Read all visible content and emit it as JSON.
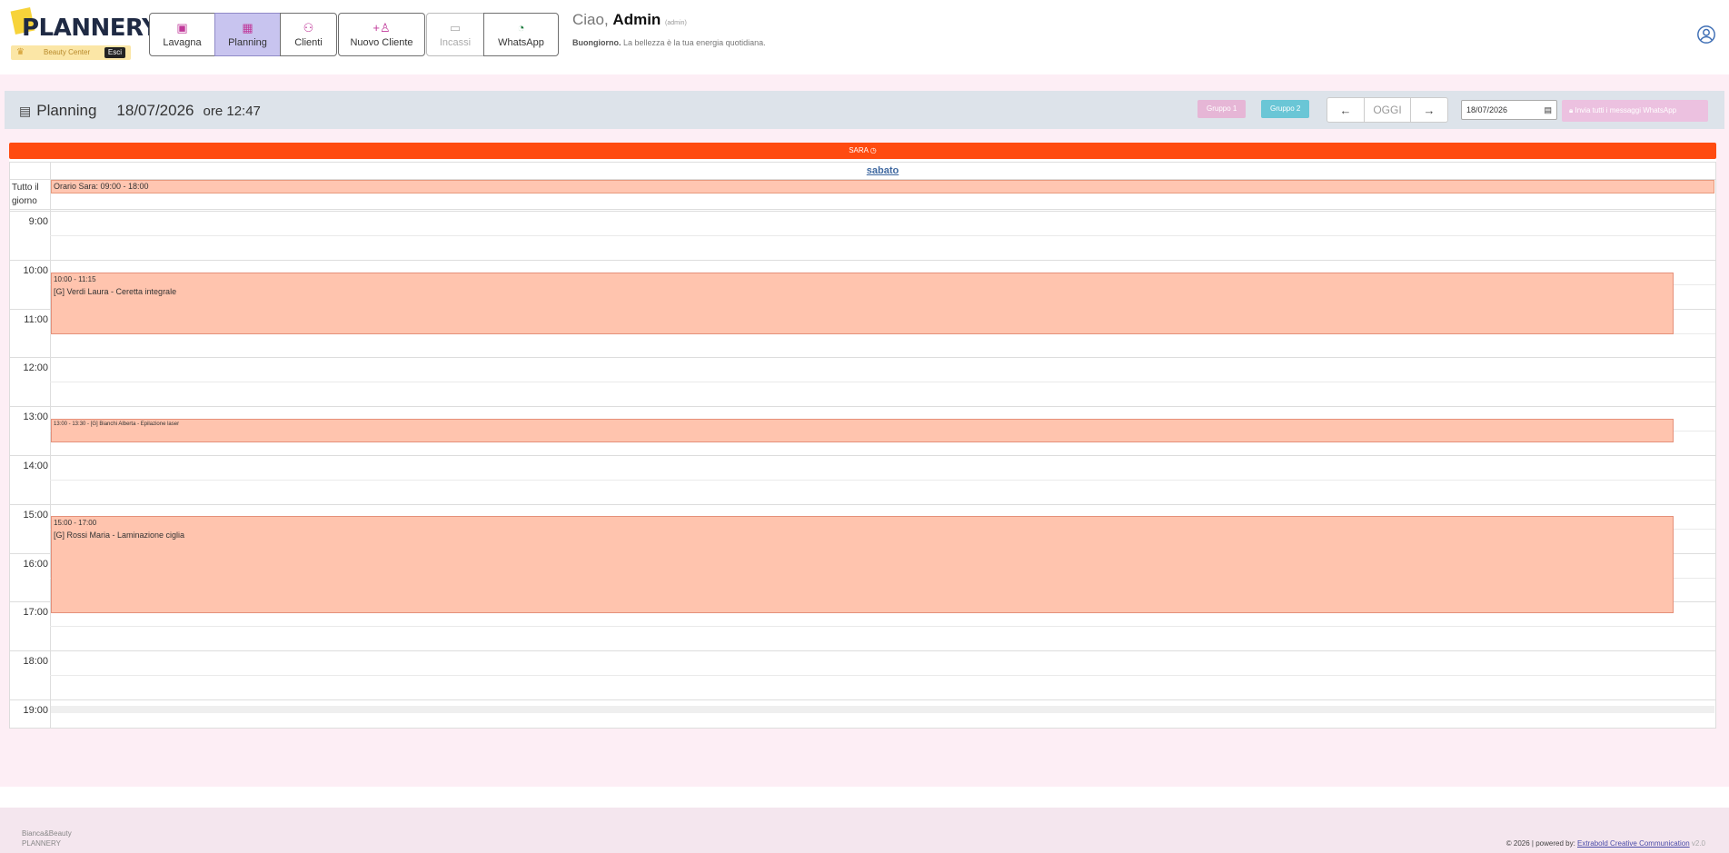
{
  "app": {
    "logo": "PLANNERY",
    "logo_sub": "Beauty Center",
    "logout": "Esci"
  },
  "nav": [
    {
      "label": "Lavagna",
      "icon": "board-icon"
    },
    {
      "label": "Planning",
      "icon": "calendar-icon"
    },
    {
      "label": "Clienti",
      "icon": "clients-icon"
    },
    {
      "label": "Nuovo Cliente",
      "icon": "add-user-icon"
    },
    {
      "label": "Incassi",
      "icon": "cash-icon"
    },
    {
      "label": "WhatsApp",
      "icon": "whatsapp-icon"
    }
  ],
  "greeting": {
    "hello": "Ciao,",
    "name": "Admin",
    "role": "(admin)",
    "salute": "Buongiorno.",
    "message": "La bellezza è la tua energia quotidiana."
  },
  "toolbar": {
    "title": "Planning",
    "date": "18/07/2026",
    "time": "ore 12:47",
    "group1": "Gruppo 1",
    "group2": "Gruppo 2",
    "today": "OGGI",
    "date_input": "18/07/2026",
    "send_all": "Invia tutti i messaggi WhatsApp"
  },
  "calendar": {
    "staff": "SARA",
    "day": "sabato",
    "allday_label": "Tutto il giorno",
    "allday_event": "Orario Sara: 09:00 - 18:00",
    "hours": [
      "9:00",
      "10:00",
      "11:00",
      "12:00",
      "13:00",
      "14:00",
      "15:00",
      "16:00",
      "17:00",
      "18:00",
      "19:00"
    ],
    "events": [
      {
        "time": "10:00 - 11:15",
        "title": "[G] Verdi Laura - Ceretta integrale"
      },
      {
        "time": "13:00 - 13:30",
        "title": "[G] Bianchi Alberta - Epilazione laser"
      },
      {
        "time": "15:00 - 17:00",
        "title": "[G] Rossi Maria - Laminazione ciglia"
      }
    ]
  },
  "footer": {
    "company": "Bianca&Beauty",
    "product": "PLANNERY",
    "copyright": "© 2026 | powered by:",
    "powered": "Extrabold Creative Communication",
    "version": "v2.0"
  },
  "colors": {
    "accent": "#ff4b10",
    "event": "#ffc4ae",
    "active_nav": "#c8c4ef",
    "band": "#fdeef5"
  }
}
